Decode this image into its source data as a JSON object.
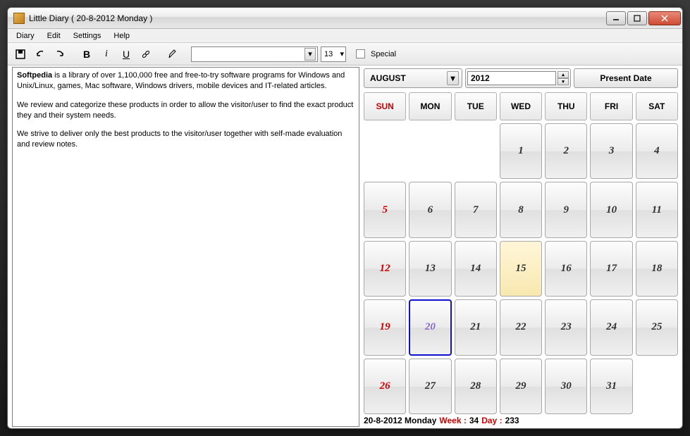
{
  "title": "Little Diary ( 20-8-2012 Monday )",
  "menu": [
    "Diary",
    "Edit",
    "Settings",
    "Help"
  ],
  "toolbar": {
    "font_size": "13",
    "special_label": "Special"
  },
  "editor": {
    "bold_word": "Softpedia",
    "p1_rest": " is a library of over 1,100,000 free and free-to-try software programs for Windows and Unix/Linux, games, Mac software, Windows drivers, mobile devices and IT-related articles.",
    "p2": "We review and categorize these products in order to allow the visitor/user to find the exact product they and their system needs.",
    "p3": "We strive to deliver only the best products to the visitor/user together with self-made evaluation and review notes."
  },
  "calendar": {
    "month": "AUGUST",
    "year": "2012",
    "present_label": "Present Date",
    "headers": [
      "SUN",
      "MON",
      "TUE",
      "WED",
      "THU",
      "FRI",
      "SAT"
    ],
    "rows": [
      [
        "",
        "",
        "",
        "1",
        "2",
        "3",
        "4"
      ],
      [
        "5",
        "6",
        "7",
        "8",
        "9",
        "10",
        "11"
      ],
      [
        "12",
        "13",
        "14",
        "15",
        "16",
        "17",
        "18"
      ],
      [
        "19",
        "20",
        "21",
        "22",
        "23",
        "24",
        "25"
      ],
      [
        "26",
        "27",
        "28",
        "29",
        "30",
        "31",
        ""
      ]
    ],
    "highlighted_day": "15",
    "selected_day": "20",
    "footer_date": "20-8-2012 Monday",
    "footer_week_label": "Week :",
    "footer_week_val": "34",
    "footer_day_label": "Day :",
    "footer_day_val": "233"
  }
}
